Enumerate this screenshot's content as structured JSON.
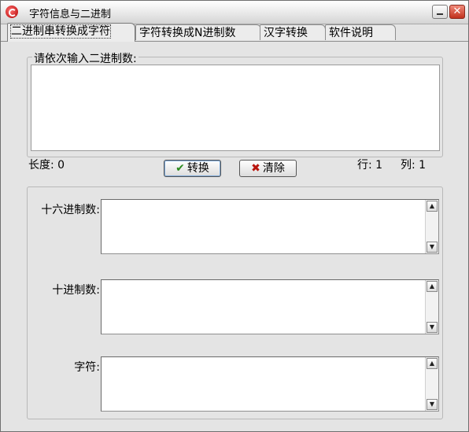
{
  "window": {
    "title": "字符信息与二进制"
  },
  "tabs": [
    {
      "label": "二进制串转换成字符"
    },
    {
      "label": "字符转换成N进制数"
    },
    {
      "label": "汉字转换"
    },
    {
      "label": "软件说明"
    }
  ],
  "input_group": {
    "label": "请依次输入二进制数:",
    "value": ""
  },
  "status": {
    "length_label": "长度:",
    "length_value": "0",
    "row_label": "行:",
    "row_value": "1",
    "col_label": "列:",
    "col_value": "1"
  },
  "buttons": {
    "convert": "转换",
    "clear": "清除"
  },
  "outputs": [
    {
      "label": "十六进制数:",
      "value": ""
    },
    {
      "label": "十进制数:",
      "value": ""
    },
    {
      "label": "字符:",
      "value": ""
    }
  ],
  "icons": {
    "convert": "check-icon",
    "clear": "x-icon",
    "scroll_up": "arrow-up-icon",
    "scroll_down": "arrow-down-icon"
  },
  "colors": {
    "check_icon": "#2a8a1e",
    "x_icon": "#b8140c",
    "close_button": "#c0301c"
  }
}
